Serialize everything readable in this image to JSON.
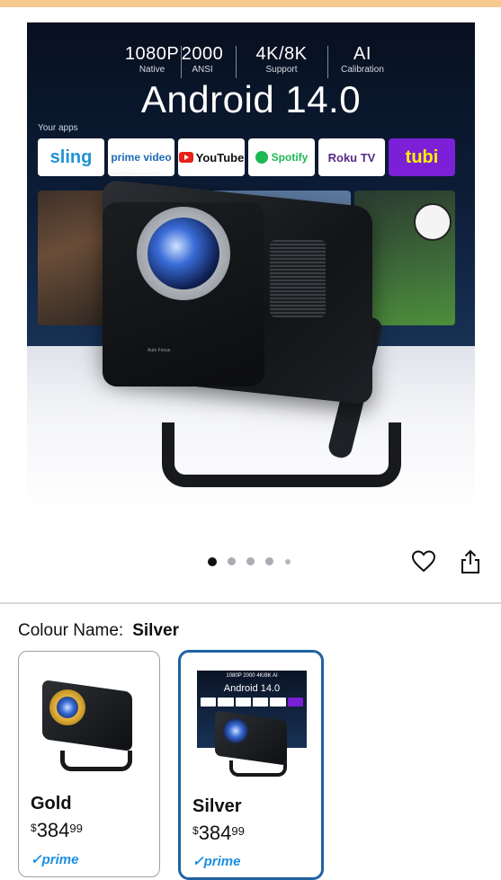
{
  "hero": {
    "stats": [
      {
        "value": "1080P",
        "sub": "Native"
      },
      {
        "value": "2000",
        "sub": "ANSI"
      },
      {
        "value": "4K/8K",
        "sub": "Support"
      },
      {
        "value": "AI",
        "sub": "Calibration"
      }
    ],
    "title": "Android 14.0",
    "your_apps_label": "Your apps",
    "apps": [
      "sling",
      "prime video",
      "YouTube",
      "Spotify",
      "Roku TV",
      "tubi"
    ],
    "projector_focus_label": "Auto Focus"
  },
  "carousel": {
    "total_dots": 5,
    "active_index": 0
  },
  "actions": {
    "wishlist_icon": "heart-icon",
    "share_icon": "share-icon"
  },
  "colour": {
    "label": "Colour Name:",
    "selected": "Silver"
  },
  "swatches": [
    {
      "name": "Gold",
      "currency": "$",
      "price_whole": "384",
      "price_cents": "99",
      "badge": "prime",
      "selected": false
    },
    {
      "name": "Silver",
      "currency": "$",
      "price_whole": "384",
      "price_cents": "99",
      "badge": "prime",
      "selected": true
    }
  ],
  "thumb_silver": {
    "stats": "1080P  2000  4K/8K  AI",
    "title": "Android 14.0"
  },
  "colors": {
    "selected_border": "#2162a1",
    "prime_blue": "#1d8fe1",
    "top_bar": "#f5c98d"
  }
}
